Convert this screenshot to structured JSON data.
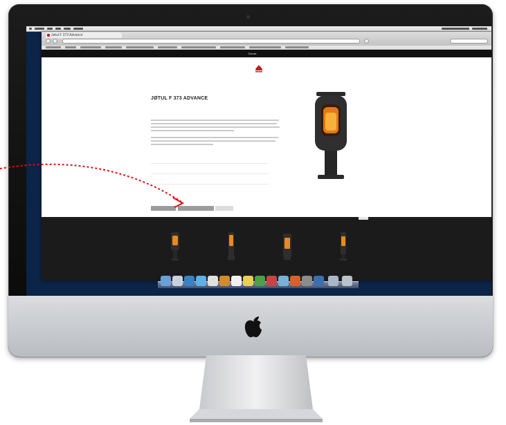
{
  "browser": {
    "tab_title": "Jøtul F 373 Advance",
    "url": ""
  },
  "site": {
    "nav": [
      "",
      "Ovner",
      "",
      "",
      "",
      ""
    ],
    "active_nav": 1
  },
  "product": {
    "title": "JØTUL F 373 ADVANCE",
    "subtitle": "",
    "specs": [
      "",
      "",
      ""
    ]
  },
  "buttons": {
    "primary": "",
    "secondary": ""
  },
  "related": [
    {
      "caption": "",
      "name": ""
    },
    {
      "caption": "",
      "name": ""
    },
    {
      "caption": "",
      "name": ""
    },
    {
      "caption": "",
      "name": ""
    }
  ],
  "colors": {
    "brand_red": "#c41e1e",
    "annotation_red": "#e01010",
    "page_bg": "#ffffff",
    "strip_bg": "#1b1b1b",
    "desktop_bg": "#0b2448"
  },
  "icons": {
    "logo": "jotul-flame-logo",
    "annotation": "dotted-arrow-icon"
  }
}
